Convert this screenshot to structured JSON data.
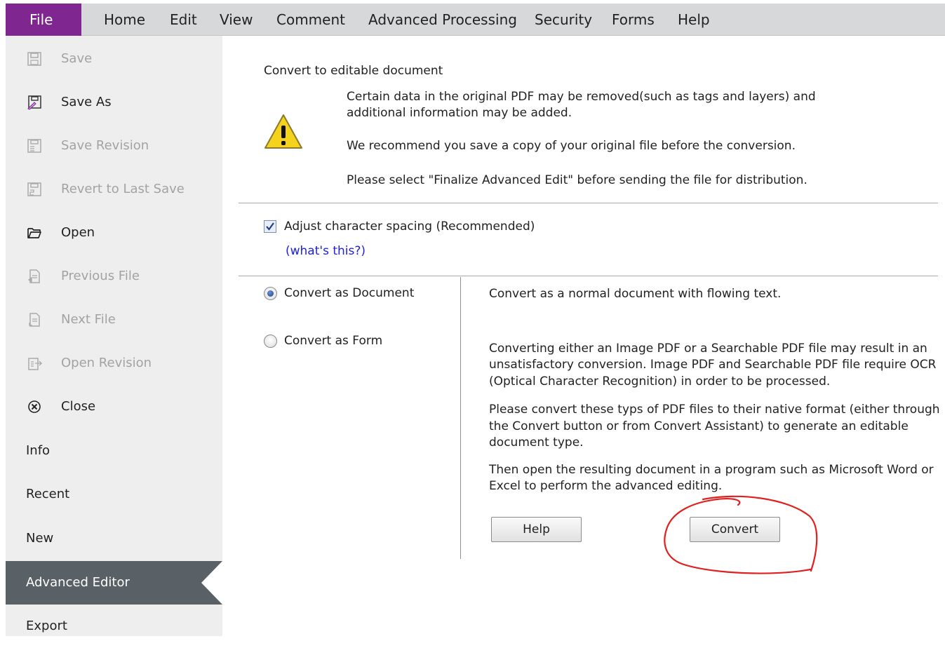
{
  "menubar": {
    "file": "File",
    "items": [
      "Home",
      "Edit",
      "View",
      "Comment",
      "Advanced Processing",
      "Security",
      "Forms",
      "Help"
    ]
  },
  "sidebar": {
    "items": [
      {
        "label": "Save",
        "icon": "save-icon"
      },
      {
        "label": "Save As",
        "icon": "save-as-icon"
      },
      {
        "label": "Save Revision",
        "icon": "save-revision-icon"
      },
      {
        "label": "Revert to Last Save",
        "icon": "revert-icon"
      },
      {
        "label": "Open",
        "icon": "folder-open-icon"
      },
      {
        "label": "Previous File",
        "icon": "previous-file-icon"
      },
      {
        "label": "Next File",
        "icon": "next-file-icon"
      },
      {
        "label": "Open Revision",
        "icon": "open-revision-icon"
      },
      {
        "label": "Close",
        "icon": "close-circle-icon"
      },
      {
        "label": "Info"
      },
      {
        "label": "Recent"
      },
      {
        "label": "New"
      },
      {
        "label": "Advanced Editor"
      },
      {
        "label": "Export"
      }
    ]
  },
  "main": {
    "heading": "Convert to editable document",
    "warning": {
      "icon": "warning-icon",
      "line1": "Certain data in the original PDF may be removed(such as tags and layers) and",
      "line2": "additional information may be added.",
      "line3": "We recommend you save a copy of your original file before the conversion.",
      "line4": "Please select \"Finalize Advanced Edit\" before sending the file for distribution."
    },
    "adjust_spacing": {
      "label": "Adjust character spacing (Recommended)",
      "checked": true,
      "link": "(what's this?)"
    },
    "options": {
      "as_document": "Convert as Document",
      "as_form": "Convert as Form",
      "selected": "Convert as Document"
    },
    "description": {
      "p1": "Convert as a normal document with flowing text.",
      "p2_l1": "Converting either an Image PDF or a Searchable PDF file may result in an",
      "p2_l2": "unsatisfactory conversion. Image PDF and Searchable PDF file require OCR",
      "p2_l3": "(Optical Character Recognition) in order to be processed.",
      "p3_l1": "Please convert these typs of PDF files to their native format (either through",
      "p3_l2": "the Convert button or from Convert Assistant) to generate an editable",
      "p3_l3": "document type.",
      "p4_l1": "Then open the resulting document in a program such as Microsoft Word or",
      "p4_l2": "Excel to perform the advanced editing."
    },
    "buttons": {
      "help": "Help",
      "convert": "Convert"
    }
  },
  "colors": {
    "file_tab": "#7f2690",
    "menubar": "#d6d8d9",
    "sidebar": "#eeeeee",
    "active_item": "#5a6166",
    "link": "#2020e0",
    "annotation": "#e02020"
  }
}
